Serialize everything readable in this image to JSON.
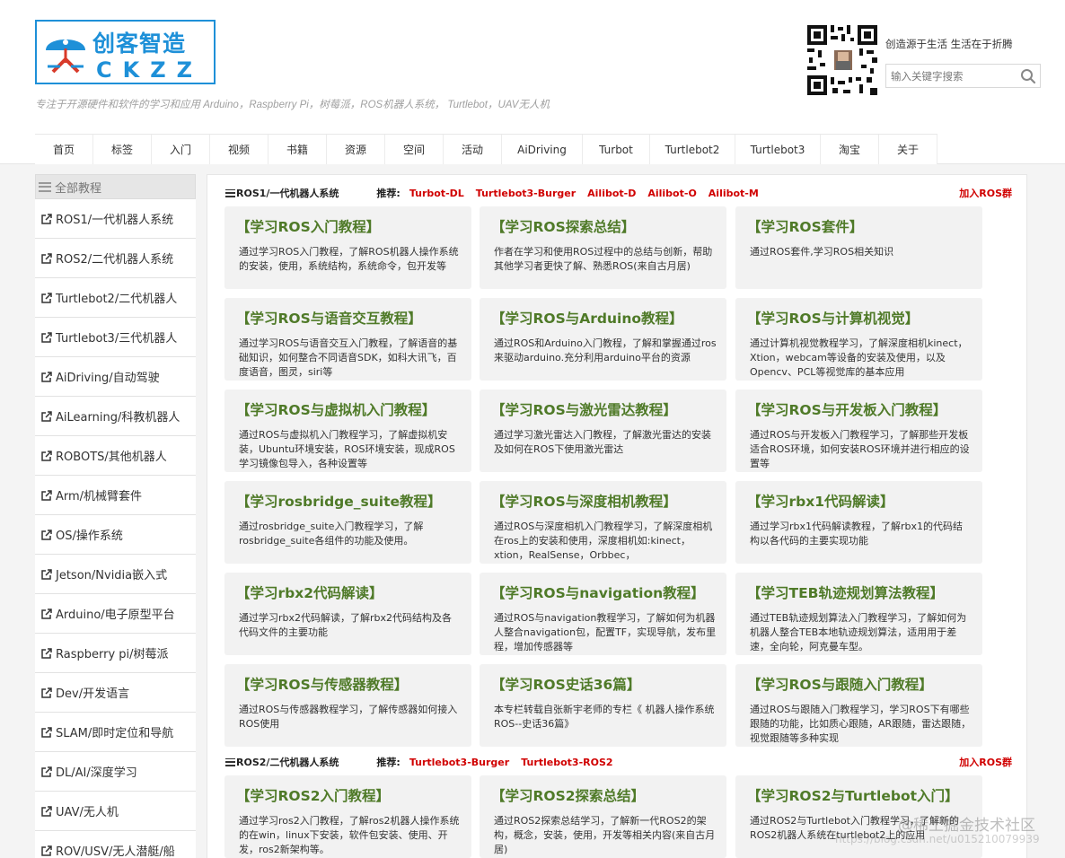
{
  "header": {
    "logo": {
      "cn_text": "创客智造",
      "en_text": "CKZZ",
      "colors": {
        "primary": "#1e90d8",
        "accent": "#d83a2a"
      }
    },
    "tagline": "专注于开源硬件和软件的学习和应用 Arduino，Raspberry Pi，树莓派，ROS机器人系统， Turtlebot，UAV无人机",
    "slogan": "创造源于生活 生活在于折腾",
    "search": {
      "placeholder": "输入关键字搜索",
      "icon": "search-icon"
    },
    "qr_icon": "qr-code-icon"
  },
  "nav": [
    {
      "label": "首页"
    },
    {
      "label": "标签"
    },
    {
      "label": "入门"
    },
    {
      "label": "视频"
    },
    {
      "label": "书籍"
    },
    {
      "label": "资源"
    },
    {
      "label": "空间"
    },
    {
      "label": "活动"
    },
    {
      "label": "AiDriving"
    },
    {
      "label": "Turbot"
    },
    {
      "label": "Turtlebot2"
    },
    {
      "label": "Turtlebot3"
    },
    {
      "label": "淘宝"
    },
    {
      "label": "关于"
    }
  ],
  "sidebar": {
    "header": "全部教程",
    "items": [
      {
        "label": "ROS1/一代机器人系统"
      },
      {
        "label": "ROS2/二代机器人系统"
      },
      {
        "label": "Turtlebot2/二代机器人"
      },
      {
        "label": "Turtlebot3/三代机器人"
      },
      {
        "label": "AiDriving/自动驾驶"
      },
      {
        "label": "AiLearning/科教机器人"
      },
      {
        "label": "ROBOTS/其他机器人"
      },
      {
        "label": "Arm/机械臂套件"
      },
      {
        "label": "OS/操作系统"
      },
      {
        "label": "Jetson/Nvidia嵌入式"
      },
      {
        "label": "Arduino/电子原型平台"
      },
      {
        "label": "Raspberry pi/树莓派"
      },
      {
        "label": "Dev/开发语言"
      },
      {
        "label": "SLAM/即时定位和导航"
      },
      {
        "label": "DL/AI/深度学习"
      },
      {
        "label": "UAV/无人机"
      },
      {
        "label": "ROV/USV/无人潜艇/船"
      }
    ]
  },
  "sections": [
    {
      "title": "ROS1/一代机器人系统",
      "rec_label": "推荐:",
      "recs": [
        "Turbot-DL",
        "Turtlebot3-Burger",
        "Ailibot-D",
        "Ailibot-O",
        "Ailibot-M"
      ],
      "join": "加入ROS群",
      "cards": [
        {
          "title": "【学习ROS入门教程】",
          "desc": "通过学习ROS入门教程，了解ROS机器人操作系统的安装，使用，系统结构，系统命令，包开发等"
        },
        {
          "title": "【学习ROS探索总结】",
          "desc": "作者在学习和使用ROS过程中的总结与创新，帮助其他学习者更快了解、熟悉ROS(来自古月居)"
        },
        {
          "title": "【学习ROS套件】",
          "desc": "通过ROS套件,学习ROS相关知识"
        },
        {
          "title": "【学习ROS与语音交互教程】",
          "desc": "通过学习ROS与语音交互入门教程，了解语音的基础知识，如何整合不同语音SDK，如科大讯飞，百度语音，图灵，siri等"
        },
        {
          "title": "【学习ROS与Arduino教程】",
          "desc": "通过ROS和Arduino入门教程，了解和掌握通过ros来驱动arduino.充分利用arduino平台的资源"
        },
        {
          "title": "【学习ROS与计算机视觉】",
          "desc": "通过计算机视觉教程学习，了解深度相机kinect，Xtion，webcam等设备的安装及使用，以及Opencv、PCL等视觉库的基本应用"
        },
        {
          "title": "【学习ROS与虚拟机入门教程】",
          "desc": "通过ROS与虚拟机入门教程学习，了解虚拟机安装，Ubuntu环境安装，ROS环境安装，现成ROS学习镜像包导入，各种设置等"
        },
        {
          "title": "【学习ROS与激光雷达教程】",
          "desc": "通过学习激光雷达入门教程，了解激光雷达的安装及如何在ROS下使用激光雷达"
        },
        {
          "title": "【学习ROS与开发板入门教程】",
          "desc": "通过ROS与开发板入门教程学习，了解那些开发板适合ROS环境，如何安装ROS环境并进行相应的设置等"
        },
        {
          "title": "【学习rosbridge_suite教程】",
          "desc": "通过rosbridge_suite入门教程学习，了解rosbridge_suite各组件的功能及使用。"
        },
        {
          "title": "【学习ROS与深度相机教程】",
          "desc": "通过ROS与深度相机入门教程学习，了解深度相机在ros上的安装和使用，深度相机如:kinect，xtion，RealSense，Orbbec，"
        },
        {
          "title": "【学习rbx1代码解读】",
          "desc": "通过学习rbx1代码解读教程，了解rbx1的代码结构以各代码的主要实现功能"
        },
        {
          "title": "【学习rbx2代码解读】",
          "desc": "通过学习rbx2代码解读，了解rbx2代码结构及各代码文件的主要功能"
        },
        {
          "title": "【学习ROS与navigation教程】",
          "desc": "通过ROS与navigation教程学习，了解如何为机器人整合navigation包，配置TF，实现导航，发布里程，增加传感器等"
        },
        {
          "title": "【学习TEB轨迹规划算法教程】",
          "desc": "通过TEB轨迹规划算法入门教程学习，了解如何为机器人整合TEB本地轨迹规划算法，适用用于差速，全向轮，阿克曼车型。"
        },
        {
          "title": "【学习ROS与传感器教程】",
          "desc": "通过ROS与传感器教程学习，了解传感器如何接入ROS使用"
        },
        {
          "title": "【学习ROS史话36篇】",
          "desc": "本专栏转载自张新宇老师的专栏《 机器人操作系统ROS--史话36篇》"
        },
        {
          "title": "【学习ROS与跟随入门教程】",
          "desc": "通过ROS与跟随入门教程学习，学习ROS下有哪些跟随的功能，比如质心跟随，AR跟随，雷达跟随，视觉跟随等多种实现"
        }
      ]
    },
    {
      "title": "ROS2/二代机器人系统",
      "rec_label": "推荐:",
      "recs": [
        "Turtlebot3-Burger",
        "Turtlebot3-ROS2"
      ],
      "join": "加入ROS群",
      "cards": [
        {
          "title": "【学习ROS2入门教程】",
          "desc": "通过学习ros2入门教程，了解ros2机器人操作系统的在win，linux下安装，软件包安装、使用、开发，ros2新架构等。"
        },
        {
          "title": "【学习ROS2探索总结】",
          "desc": "通过ROS2探索总结学习，了解新一代ROS2的架构，概念，安装，使用，开发等相关内容(来自古月居)"
        },
        {
          "title": "【学习ROS2与Turtlebot入门】",
          "desc": "通过ROS2与Turtlebot入门教程学习，了解新的ROS2机器人系统在turtlebot2上的应用"
        }
      ]
    }
  ],
  "watermark": {
    "main": "@稀土掘金技术社区",
    "sub": "https://blog.csdn.net/u015210079939"
  },
  "colors": {
    "card_title": "#4f7a28",
    "recommend": "#d00000",
    "brand_blue": "#1e90d8"
  }
}
